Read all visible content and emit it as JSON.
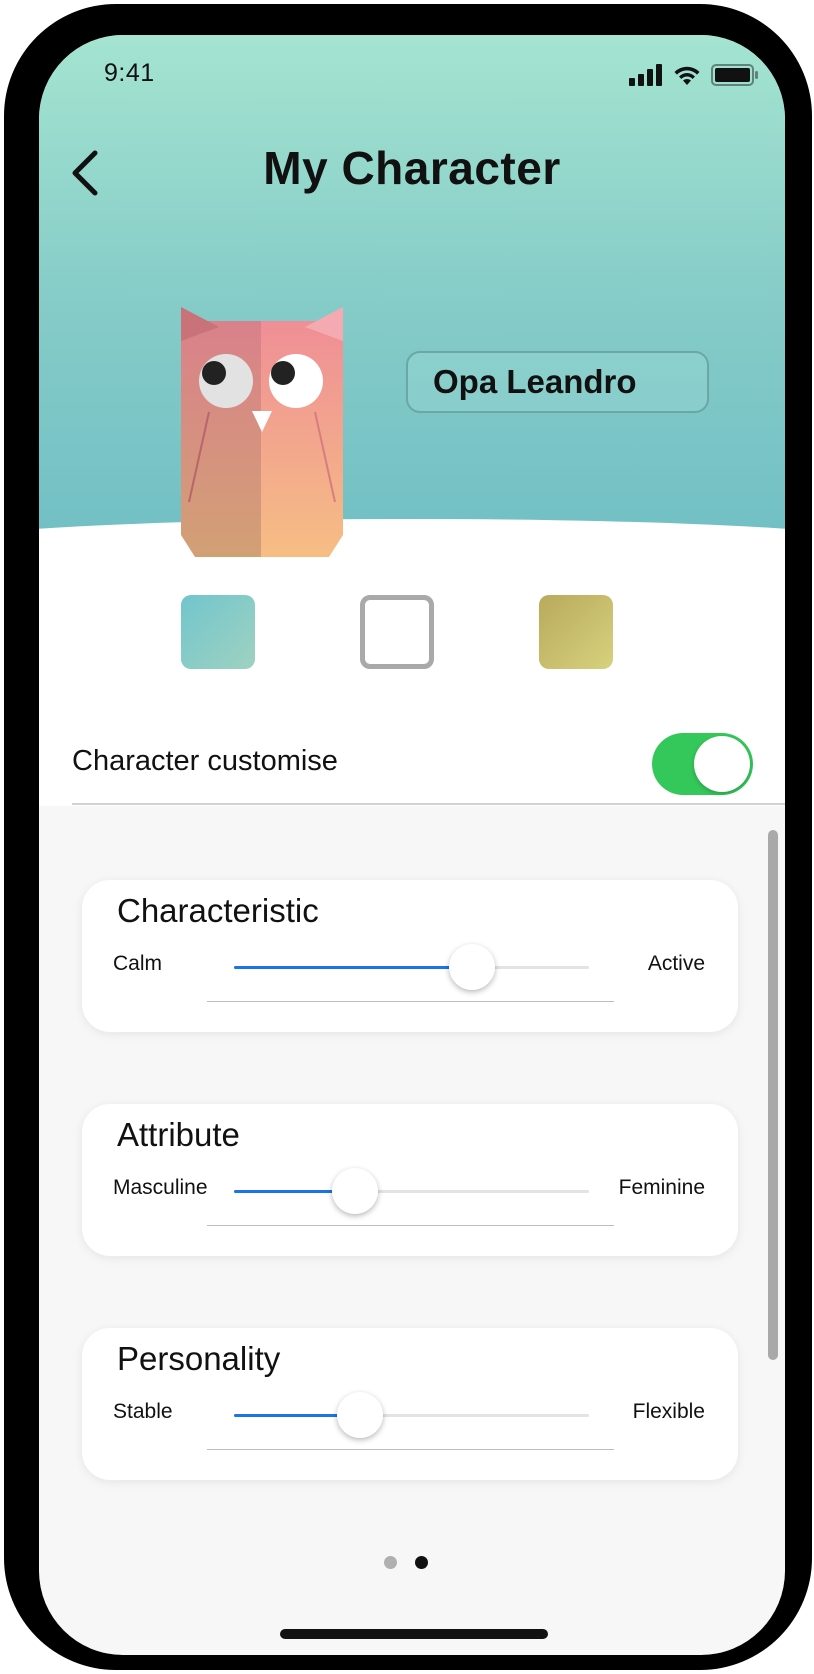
{
  "status_bar": {
    "time": "9:41"
  },
  "header": {
    "title": "My Character",
    "back_icon": "chevron-left-icon"
  },
  "character": {
    "name": "Opa Leandro",
    "avatar": "owl-origami"
  },
  "color_options": [
    {
      "name": "teal",
      "color": "#7ccbc9",
      "selected": false
    },
    {
      "name": "white",
      "color": "#ffffff",
      "selected": true
    },
    {
      "name": "olive",
      "color": "#c5bd6c",
      "selected": false
    }
  ],
  "customise": {
    "label": "Character customise",
    "enabled": true,
    "toggle_color": "#34c759"
  },
  "sliders": [
    {
      "title": "Characteristic",
      "left_label": "Calm",
      "right_label": "Active",
      "value": 0.67
    },
    {
      "title": "Attribute",
      "left_label": "Masculine",
      "right_label": "Feminine",
      "value": 0.34
    },
    {
      "title": "Personality",
      "left_label": "Stable",
      "right_label": "Flexible",
      "value": 0.355
    }
  ],
  "pagination": {
    "pages": 2,
    "current": 2
  },
  "accent_color": "#1a73e8"
}
